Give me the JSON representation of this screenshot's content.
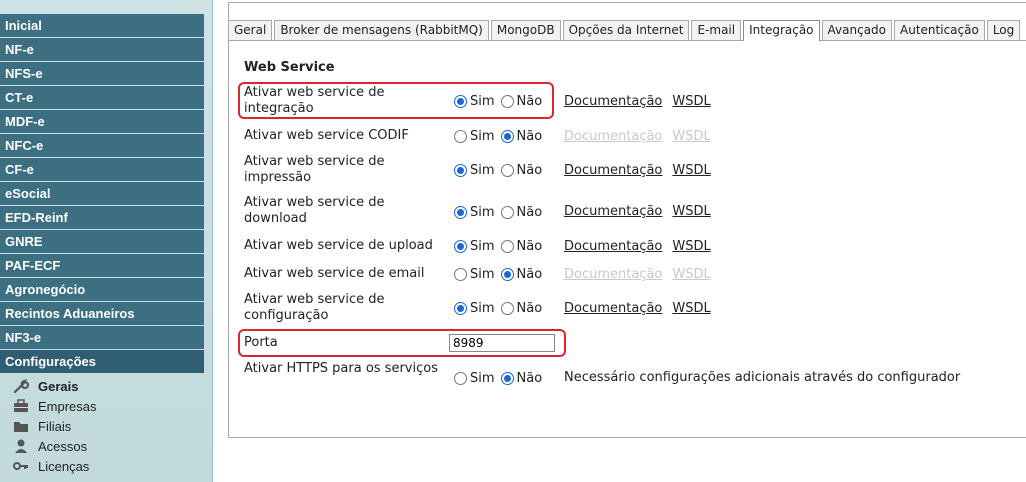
{
  "sidebar": {
    "items": [
      "Inicial",
      "NF-e",
      "NFS-e",
      "CT-e",
      "MDF-e",
      "NFC-e",
      "CF-e",
      "eSocial",
      "EFD-Reinf",
      "GNRE",
      "PAF-ECF",
      "Agronegócio",
      "Recintos Aduaneiros",
      "NF3-e",
      "Configurações"
    ],
    "sub_items": [
      {
        "label": "Gerais",
        "icon": "wrench-icon"
      },
      {
        "label": "Empresas",
        "icon": "briefcase-icon"
      },
      {
        "label": "Filiais",
        "icon": "folder-icon"
      },
      {
        "label": "Acessos",
        "icon": "user-icon"
      },
      {
        "label": "Licenças",
        "icon": "key-icon"
      }
    ]
  },
  "tabs": [
    "Geral",
    "Broker de mensagens (RabbitMQ)",
    "MongoDB",
    "Opções da Internet",
    "E-mail",
    "Integração",
    "Avançado",
    "Autenticação",
    "Log"
  ],
  "active_tab": "Integração",
  "section_title": "Web Service",
  "options": {
    "yes": "Sim",
    "no": "Não",
    "doc_link": "Documentação",
    "wsdl_link": "WSDL"
  },
  "rows": {
    "integracao": {
      "label": "Ativar web service de integração",
      "value": "Sim"
    },
    "codif": {
      "label": "Ativar web service CODIF",
      "value": "Não"
    },
    "impressao": {
      "label": "Ativar web service de impressão",
      "value": "Sim"
    },
    "download": {
      "label": "Ativar web service de download",
      "value": "Sim"
    },
    "upload": {
      "label": "Ativar web service de upload",
      "value": "Sim"
    },
    "email": {
      "label": "Ativar web service de email",
      "value": "Não"
    },
    "configuracao": {
      "label": "Ativar web service de configuração",
      "value": "Sim"
    },
    "porta": {
      "label": "Porta",
      "value": "8989"
    },
    "https": {
      "label": "Ativar HTTPS para os serviços",
      "value": "Não",
      "note": "Necessário configurações adicionais através do configurador"
    }
  },
  "colors": {
    "nav_bg": "#3d6f83",
    "highlight": "#e0242e",
    "radio": "#1a66d6"
  }
}
